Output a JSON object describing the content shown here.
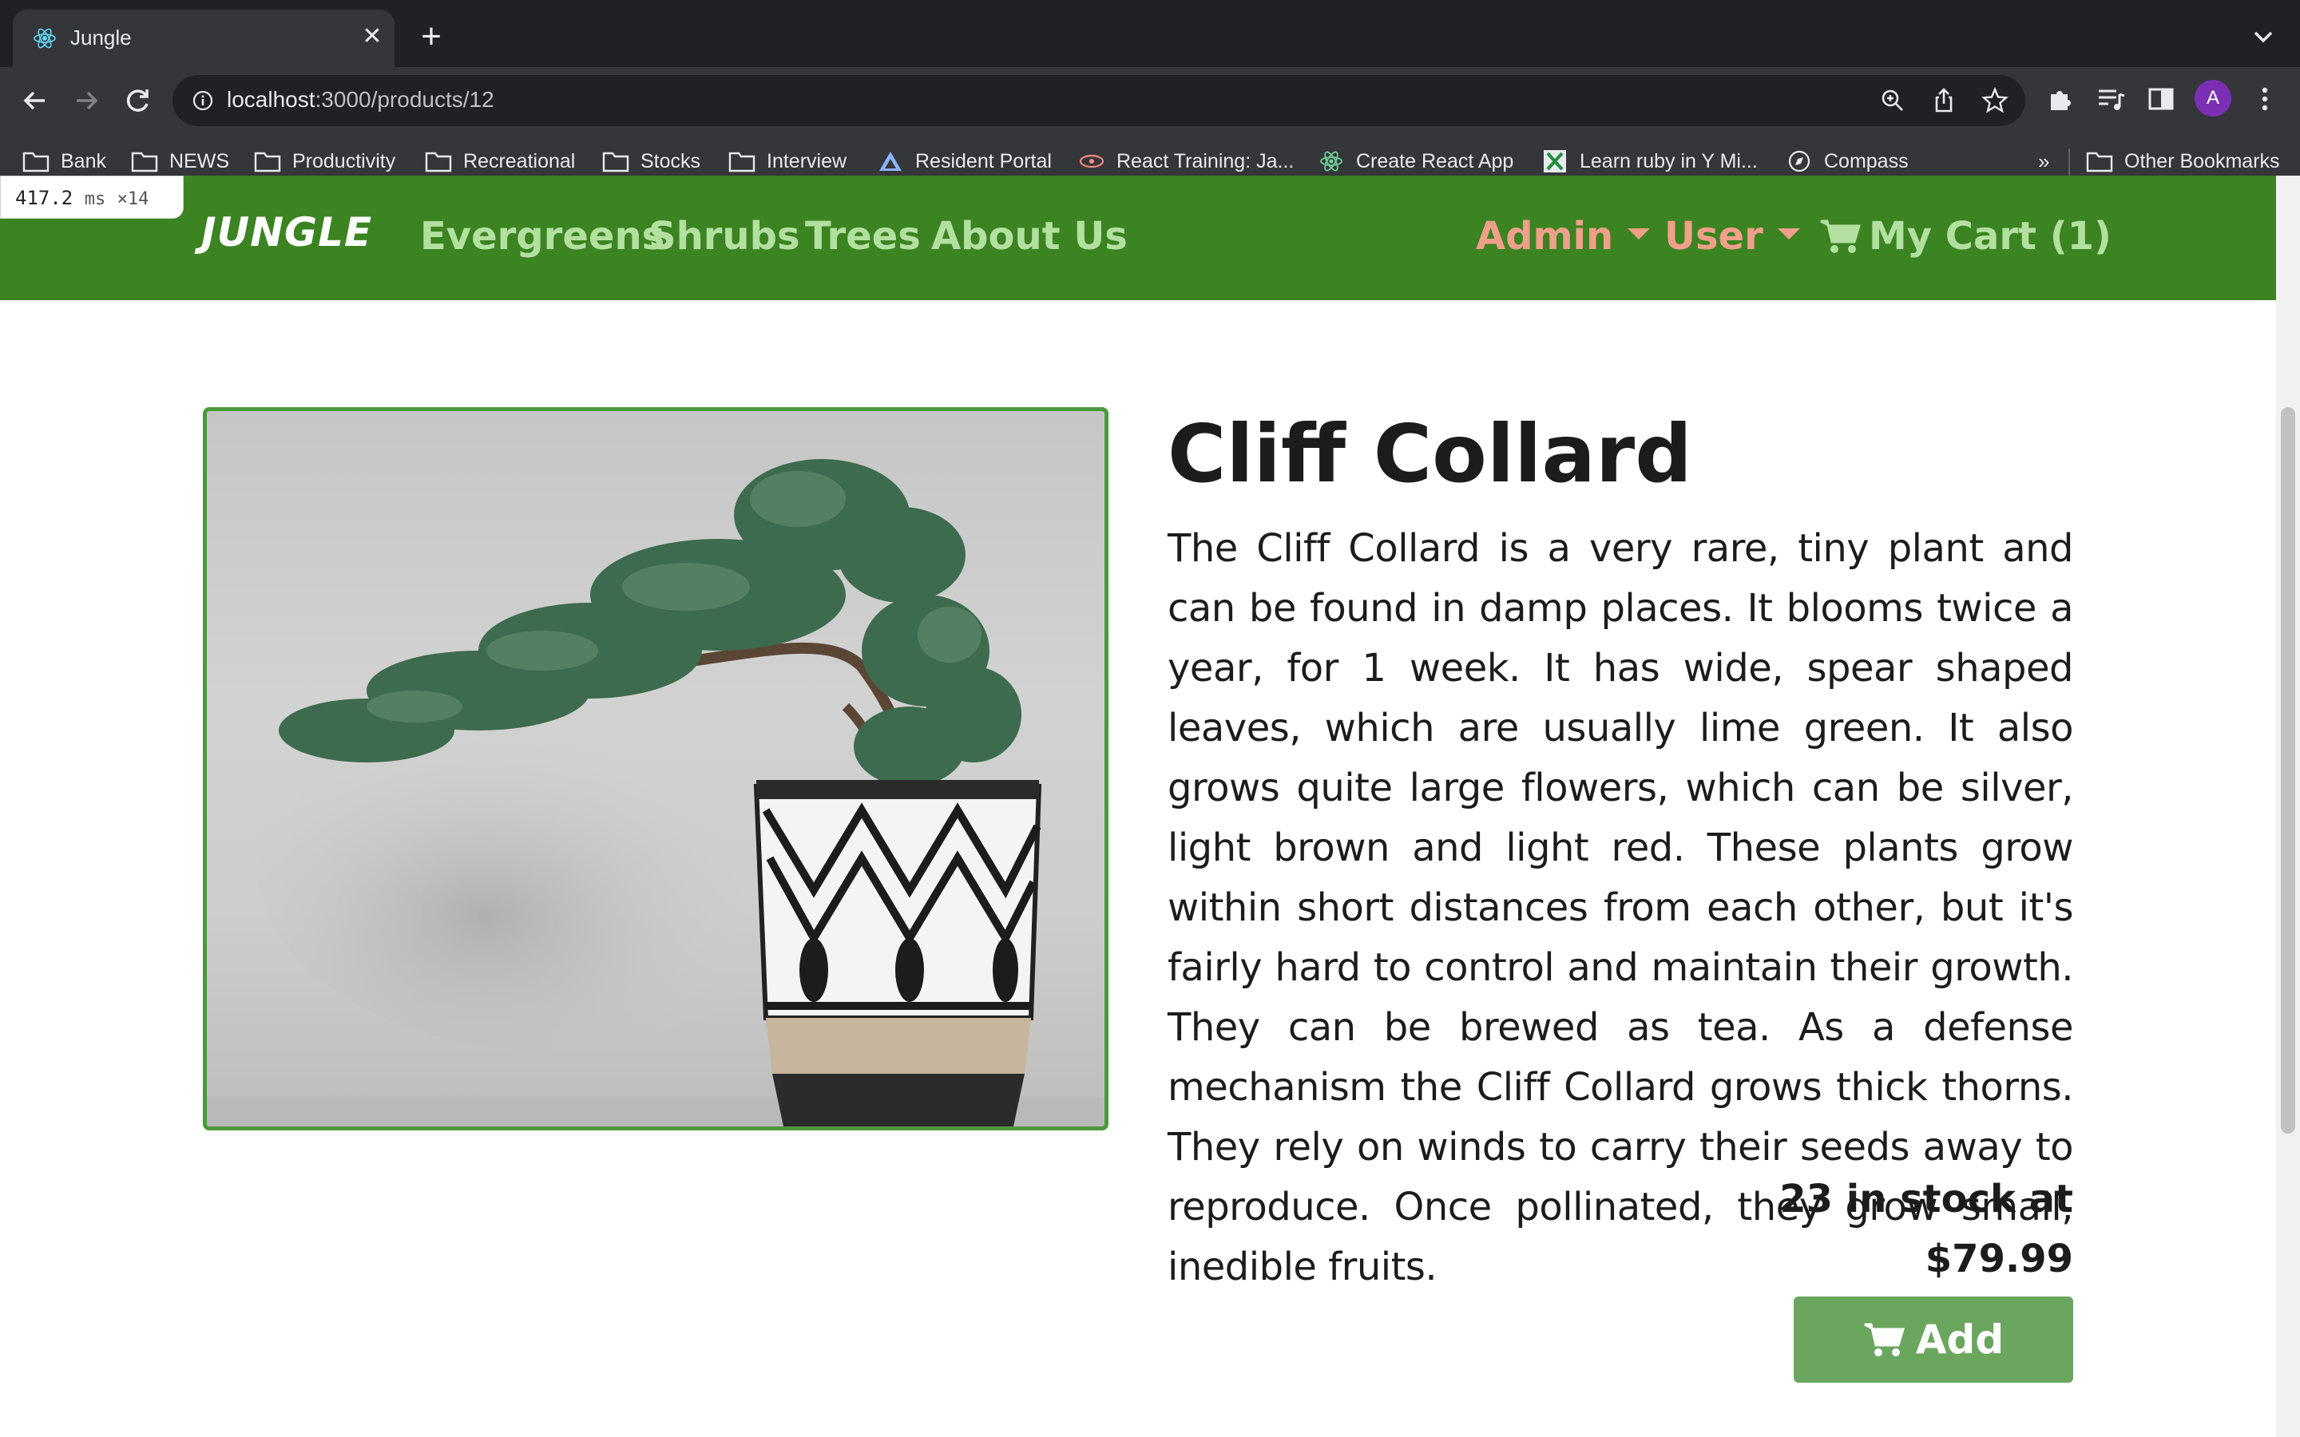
{
  "browser": {
    "tab_title": "Jungle",
    "url_host": "localhost",
    "url_path": ":3000/products/12",
    "profile_initial": "A",
    "overflow_label": "»",
    "bookmarks": [
      {
        "label": "Bank",
        "icon": "folder-icon"
      },
      {
        "label": "NEWS",
        "icon": "folder-icon"
      },
      {
        "label": "Productivity",
        "icon": "folder-icon"
      },
      {
        "label": "Recreational",
        "icon": "folder-icon"
      },
      {
        "label": "Stocks",
        "icon": "folder-icon"
      },
      {
        "label": "Interview",
        "icon": "folder-icon"
      },
      {
        "label": "Resident Portal",
        "icon": "site-icon"
      },
      {
        "label": "React Training: Ja...",
        "icon": "site-icon"
      },
      {
        "label": "Create React App",
        "icon": "react-icon"
      },
      {
        "label": "Learn ruby in Y Mi...",
        "icon": "site-icon"
      },
      {
        "label": "Compass",
        "icon": "compass-icon"
      }
    ],
    "other_bookmarks": "Other Bookmarks"
  },
  "perf_badge": {
    "value": "417.2",
    "unit": "ms",
    "count": "×14"
  },
  "site_nav": {
    "brand": "JUNGLE",
    "links": [
      "Evergreens",
      "Shrubs",
      "Trees",
      "About Us"
    ],
    "admin_label": "Admin",
    "user_label": "User",
    "cart_label": "My Cart (1)"
  },
  "product": {
    "title": "Cliff Collard",
    "description": "The Cliff Collard is a very rare, tiny plant and can be found in damp places. It blooms twice a year, for 1 week. It has wide, spear shaped leaves, which are usually lime green. It also grows quite large flowers, which can be silver, light brown and light red. These plants grow within short distances from each other, but it's fairly hard to control and maintain their growth. They can be brewed as tea. As a defense mechanism the Cliff Collard grows thick thorns. They rely on winds to carry their seeds away to reproduce. Once pollinated, they grow small, inedible fruits.",
    "stock_line": "23 in stock at",
    "price": "$79.99",
    "add_label": "Add"
  },
  "colors": {
    "nav_bg": "#3b8421",
    "nav_link": "#b3e0a0",
    "nav_dropdown": "#f0a08a",
    "button_bg": "#6ba65e",
    "image_border": "#4c9a3c"
  }
}
